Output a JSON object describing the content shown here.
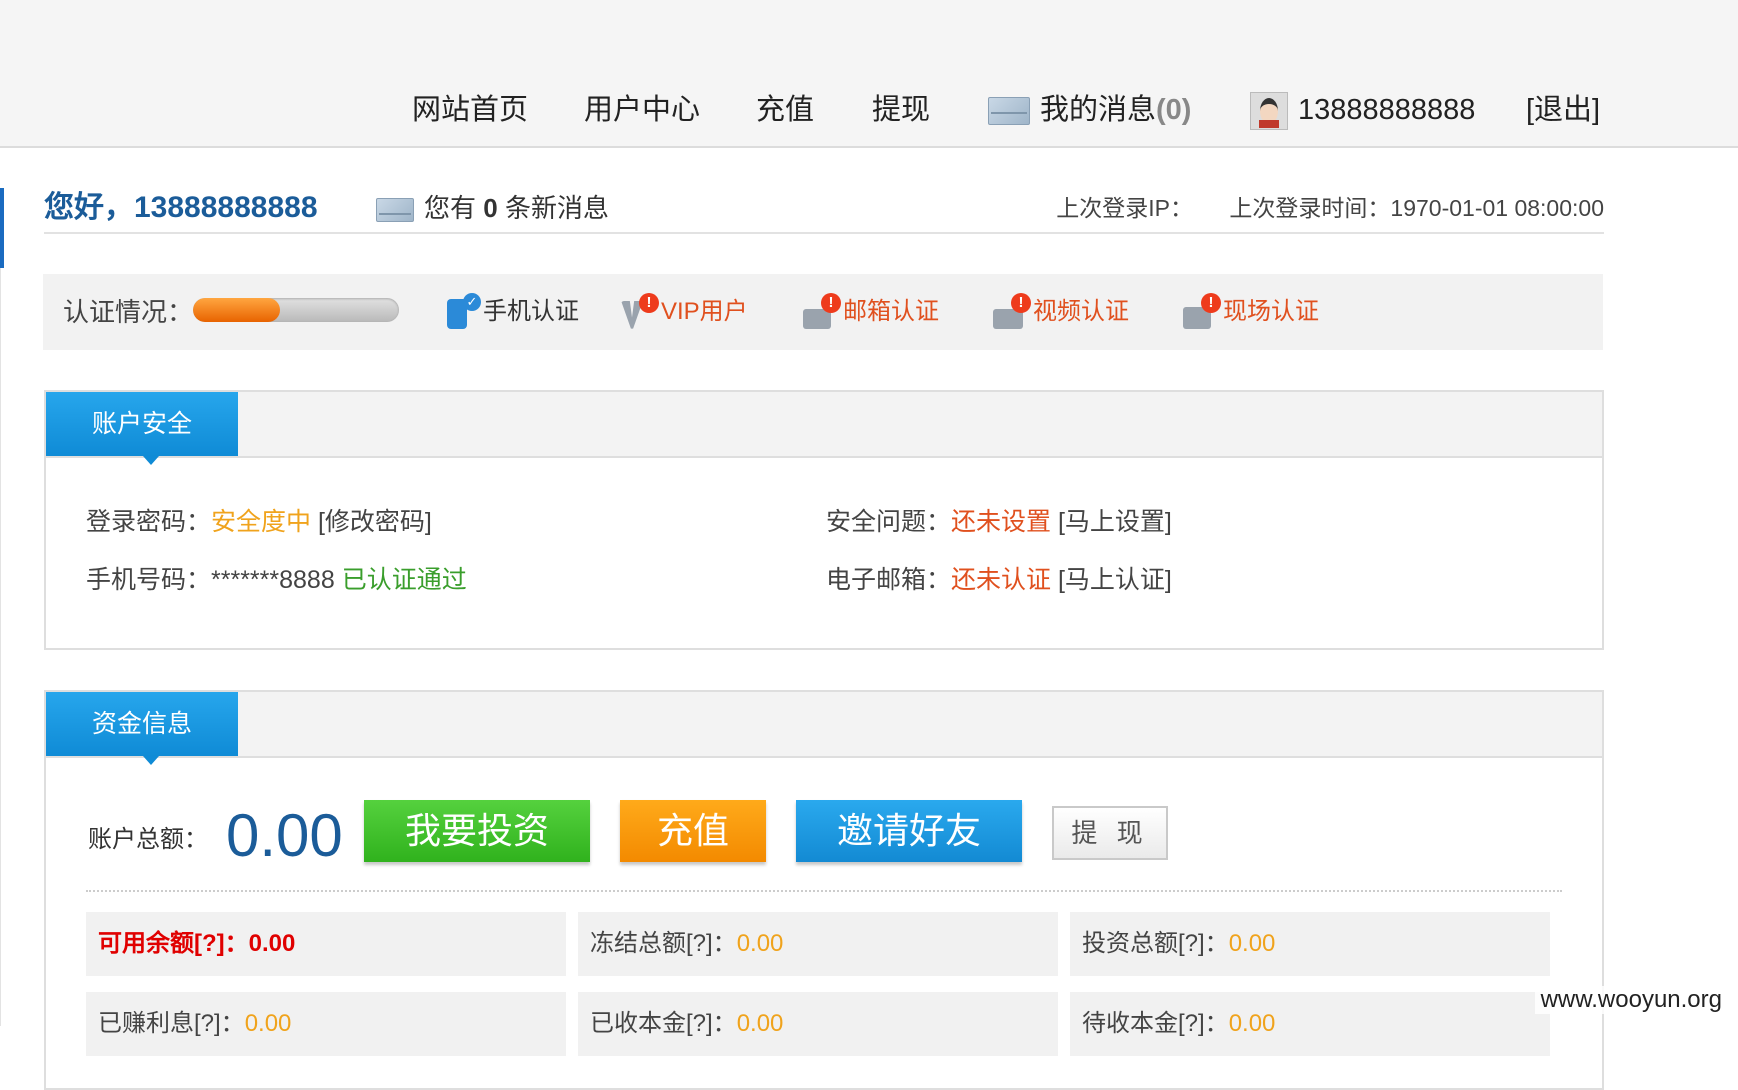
{
  "nav": {
    "home": "网站首页",
    "user_center": "用户中心",
    "recharge": "充值",
    "withdraw": "提现",
    "messages_label": "我的消息",
    "messages_count": "(0)",
    "username": "13888888888",
    "logout": "[退出]"
  },
  "greeting": {
    "text": "您好，13888888888",
    "msg_prefix": "您有",
    "msg_count": "0",
    "msg_suffix": "条新消息",
    "last_ip_label": "上次登录IP：",
    "last_time_label": "上次登录时间：",
    "last_time_value": "1970-01-01 08:00:00"
  },
  "certification": {
    "label": "认证情况：",
    "progress": 0.42,
    "items": [
      {
        "label": "手机认证",
        "status": "done"
      },
      {
        "label": "VIP用户",
        "status": "todo"
      },
      {
        "label": "邮箱认证",
        "status": "todo"
      },
      {
        "label": "视频认证",
        "status": "todo"
      },
      {
        "label": "现场认证",
        "status": "todo"
      }
    ],
    "badge": "!",
    "check": "✓"
  },
  "security": {
    "title": "账户安全",
    "password_label": "登录密码：",
    "password_status": "安全度中",
    "password_action": "[修改密码]",
    "phone_label": "手机号码：",
    "phone_value": "*******8888",
    "phone_status": "已认证通过",
    "question_label": "安全问题：",
    "question_status": "还未设置",
    "question_action": "[马上设置]",
    "email_label": "电子邮箱：",
    "email_status": "还未认证",
    "email_action": "[马上认证]"
  },
  "funds": {
    "title": "资金信息",
    "total_label": "账户总额：",
    "total_value": "0.00",
    "buttons": {
      "invest": "我要投资",
      "recharge": "充值",
      "invite": "邀请好友",
      "withdraw": "提 现"
    },
    "stats": [
      {
        "label": "可用余额[?]：",
        "value": "0.00"
      },
      {
        "label": "冻结总额[?]：",
        "value": "0.00"
      },
      {
        "label": "投资总额[?]：",
        "value": "0.00"
      },
      {
        "label": "已赚利息[?]：",
        "value": "0.00"
      },
      {
        "label": "已收本金[?]：",
        "value": "0.00"
      },
      {
        "label": "待收本金[?]：",
        "value": "0.00"
      }
    ]
  },
  "watermark": "www.wooyun.org",
  "colors": {
    "accent_blue": "#1b8fd8",
    "brand_blue": "#1b5c99",
    "warn_orange": "#f0a31c",
    "alert_red": "#e0501e",
    "ok_green": "#3a9e2c"
  }
}
